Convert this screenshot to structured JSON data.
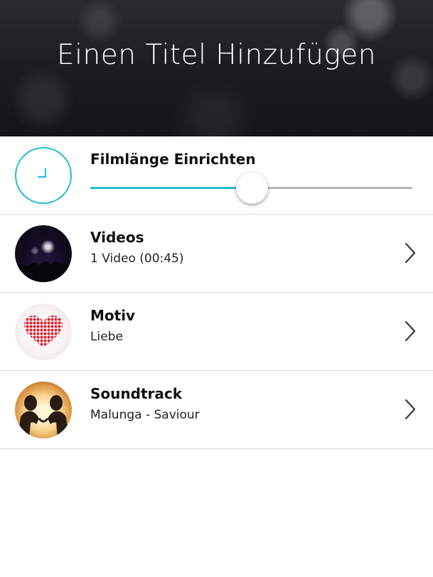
{
  "header": {
    "title": "Einen Titel Hinzufügen"
  },
  "duration": {
    "label": "Filmlänge Einrichten",
    "icon": "clock-icon",
    "slider_value_fraction": 0.5
  },
  "items": [
    {
      "title": "Videos",
      "subtitle": "1 Video (00:45)",
      "thumb_icon": "concert-photo"
    },
    {
      "title": "Motiv",
      "subtitle": "Liebe",
      "thumb_icon": "hearts-image"
    },
    {
      "title": "Soundtrack",
      "subtitle": "Malunga - Saviour",
      "thumb_icon": "couple-silhouette-photo"
    }
  ],
  "colors": {
    "accent": "#1fbcd4",
    "track": "#b5b5b5",
    "header_bg": "#1c1c1f",
    "heart": "#d8262f"
  }
}
